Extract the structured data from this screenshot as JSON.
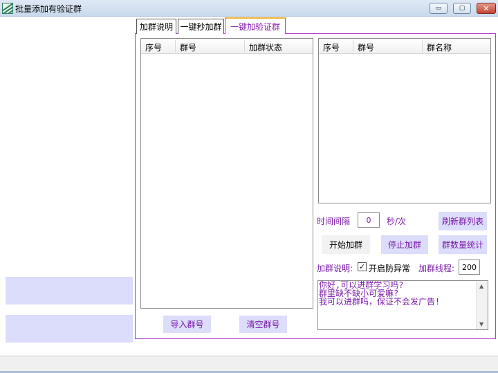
{
  "window": {
    "title": "批量添加有验证群",
    "controls": {
      "minimize": "▭",
      "maximize": "▢",
      "close": "✕"
    }
  },
  "tabs": [
    {
      "label": "加群说明",
      "active": false
    },
    {
      "label": "一键秒加群",
      "active": false
    },
    {
      "label": "一键加验证群",
      "active": true
    }
  ],
  "left_list": {
    "columns": [
      "序号",
      "群号",
      "加群状态"
    ]
  },
  "right_list": {
    "columns": [
      "序号",
      "群号",
      "群名称"
    ]
  },
  "buttons": {
    "import": "导入群号",
    "clear": "清空群号",
    "refresh": "刷新群列表",
    "start": "开始加群",
    "stop": "停止加群",
    "stats": "群数量统计"
  },
  "settings": {
    "interval_label": "时间间隔",
    "interval_value": "0",
    "interval_unit": "秒/次",
    "desc_label": "加群说明:",
    "anti_abnormal_label": "开启防异常",
    "anti_abnormal_checked": true,
    "thread_label": "加群线程:",
    "thread_value": "200"
  },
  "message": {
    "text": "你好,可以进群学习吗?\n群里缺不缺小可爱嘛?\n我可以进群吗，保证不会发广告!"
  },
  "colors": {
    "accent": "#7a1aa8",
    "button_bg": "#dcdcfb",
    "tab_border": "#b03fcf"
  }
}
